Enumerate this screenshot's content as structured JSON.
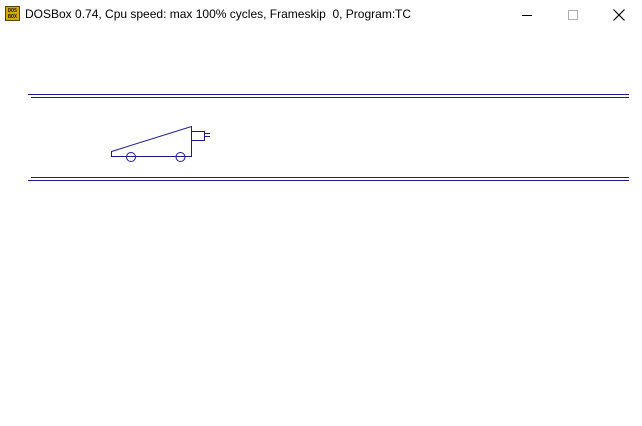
{
  "window": {
    "title": "DOSBox 0.74, Cpu speed: max 100% cycles, Frameskip  0, Program:",
    "program": "TC",
    "icon": "dosbox-icon",
    "icon_text_top": "DOS",
    "icon_text_bottom": "BOX"
  },
  "controls": {
    "minimize": "minimize-icon",
    "maximize": "maximize-icon",
    "close": "close-icon"
  },
  "colors": {
    "line": "#1a1a8c",
    "background": "#ffffff"
  }
}
